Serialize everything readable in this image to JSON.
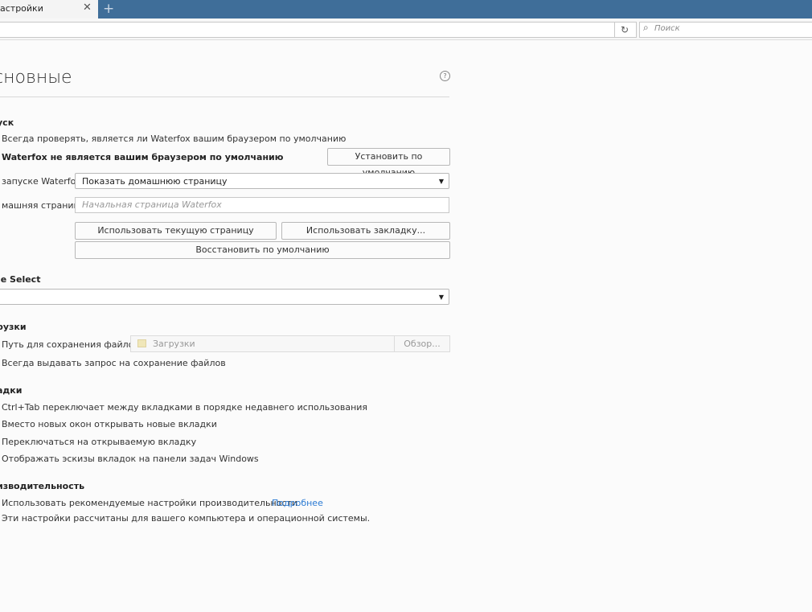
{
  "tab": {
    "title": "астройки",
    "close": "✕",
    "new_tab": "+"
  },
  "navbar": {
    "reload": "↻",
    "search_placeholder": "Поиск"
  },
  "page": {
    "title": "сновные",
    "help": "?"
  },
  "startup": {
    "heading": "уск",
    "always_check": "Всегда проверять, является ли Waterfox вашим браузером по умолчанию",
    "not_default": "Waterfox не является вашим браузером по умолчанию",
    "set_default_button": "Установить по умолчанию",
    "on_launch_label": "запуске Waterfox:",
    "on_launch_value": "Показать домашнюю страницу",
    "homepage_label": "машняя страница:",
    "homepage_placeholder": "Начальная страница Waterfox",
    "use_current_button": "Использовать текущую страницу",
    "use_bookmark_button": "Использовать закладку...",
    "restore_default_button": "Восстановить по умолчанию"
  },
  "locale_select": {
    "heading": "le Select",
    "value": ""
  },
  "downloads": {
    "heading": "рузки",
    "save_path_label": "Путь для сохранения файлов",
    "save_path_value": "Загрузки",
    "browse_button": "Обзор...",
    "always_ask": "Всегда выдавать запрос на сохранение файлов"
  },
  "tabs": {
    "heading": "адки",
    "ctrl_tab": "Ctrl+Tab переключает между вкладками в порядке недавнего использования",
    "open_new_tabs": "Вместо новых окон открывать новые вкладки",
    "switch_to_tab": "Переключаться на открываемую вкладку",
    "taskbar_previews": "Отображать эскизы вкладок на панели задач Windows"
  },
  "performance": {
    "heading": "изводительность",
    "recommended": "Использовать рекомендуемые настройки производительности",
    "learn_more": "Подробнее",
    "note": "Эти настройки рассчитаны для вашего компьютера и операционной системы."
  }
}
